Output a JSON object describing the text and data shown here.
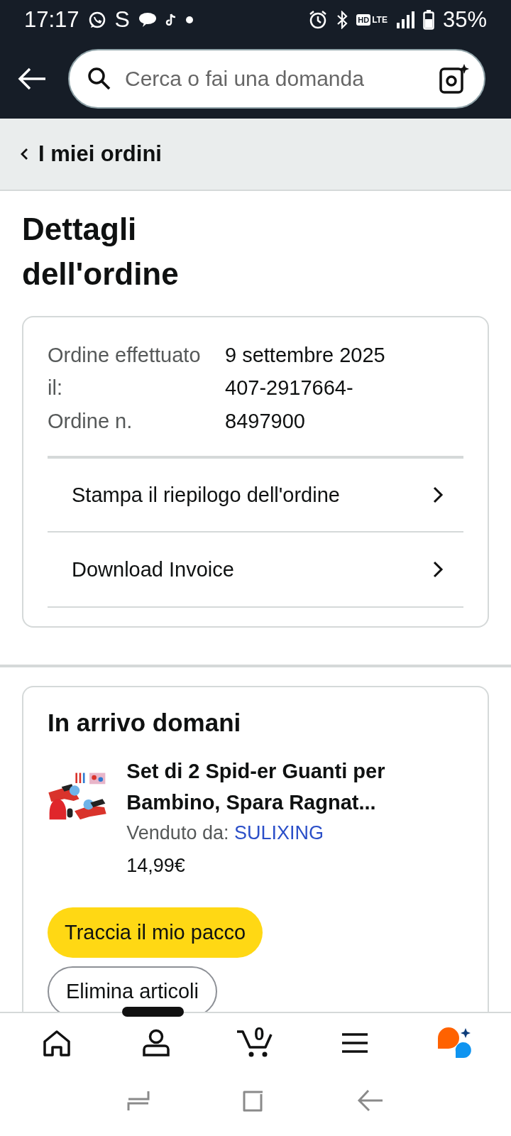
{
  "status_bar": {
    "time": "17:17",
    "notification_letter": "S",
    "network_badges": [
      "HD",
      "LTE"
    ],
    "battery": "35%"
  },
  "header": {
    "search": {
      "placeholder": "Cerca o fai una domanda"
    }
  },
  "breadcrumb": {
    "label": "I miei ordini"
  },
  "page_title": "Dettagli dell'ordine",
  "order_summary": {
    "labels": [
      "Ordine effettuato il:",
      "Ordine n."
    ],
    "values": [
      "9 settembre 2025",
      "407-2917664-8497900"
    ],
    "links": [
      {
        "label": "Stampa il riepilogo dell'ordine"
      },
      {
        "label": "Download Invoice"
      }
    ]
  },
  "shipment": {
    "status": "In arrivo domani",
    "product": {
      "kind": "picture",
      "title": "Set di 2 Spid-er Guanti per Bambino, Spara Ragnat...",
      "seller_label": "Venduto da:",
      "seller": "SULIXING",
      "price": "14,99€"
    },
    "buttons": [
      {
        "kind": "primary",
        "label": "Traccia il mio pacco"
      },
      {
        "kind": "secondary",
        "label": "Elimina articoli"
      }
    ]
  },
  "bottom_nav": {
    "items": [
      {
        "kind": "home"
      },
      {
        "kind": "account"
      },
      {
        "kind": "cart",
        "count": "0"
      },
      {
        "kind": "menu"
      },
      {
        "kind": "assistant"
      }
    ]
  },
  "system_nav": {
    "items": [
      {
        "kind": "recents"
      },
      {
        "kind": "home"
      },
      {
        "kind": "back"
      }
    ]
  }
}
